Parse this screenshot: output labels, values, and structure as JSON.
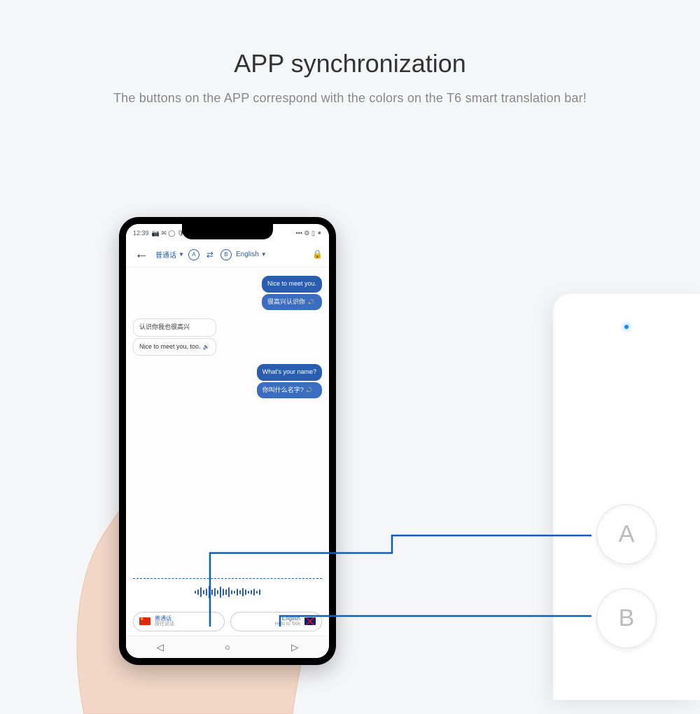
{
  "hero": {
    "title": "APP synchronization",
    "subtitle": "The buttons on the APP correspond with the colors on the T6 smart translation bar!"
  },
  "phone": {
    "status": {
      "time": "12:39",
      "icons_left": "📷 ✉ ◯ 🛡 ⬆",
      "icons_right": "••• ⚙ ▯ ✶"
    },
    "header": {
      "lang_a": "普通话",
      "badge_a": "A",
      "badge_b": "B",
      "lang_b": "English"
    },
    "chat": [
      {
        "side": "right",
        "blue": "Nice to meet you.",
        "white": "很高兴认识你"
      },
      {
        "side": "left",
        "blue": "认识你我也很高兴",
        "white": "Nice to meet you, too."
      },
      {
        "side": "right",
        "blue": "What's your name?",
        "white": "你叫什么名字?"
      }
    ],
    "bottom": {
      "btn_a": {
        "lang": "普通话",
        "sub": "按住说话"
      },
      "btn_b": {
        "lang": "English",
        "sub": "Hold to Talk"
      }
    },
    "nav": {
      "back": "◁",
      "home": "○",
      "recent": "▷"
    }
  },
  "device": {
    "btn_a": "A",
    "btn_b": "B"
  }
}
